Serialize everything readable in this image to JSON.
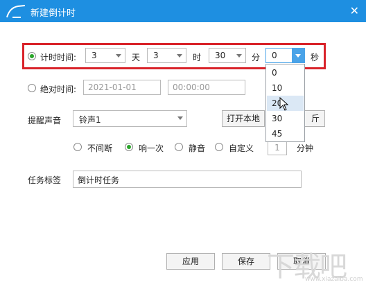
{
  "window": {
    "title": "新建倒计时",
    "close_glyph": "✕"
  },
  "countdown": {
    "label": "计时时间:",
    "days_value": "3",
    "days_unit": "天",
    "hours_value": "3",
    "hours_unit": "时",
    "minutes_value": "30",
    "minutes_unit": "分",
    "seconds_value": "0",
    "seconds_unit": "秒",
    "seconds_options": [
      "0",
      "10",
      "20",
      "30",
      "45"
    ],
    "hovered_option": "20"
  },
  "absolute": {
    "label": "绝对时间:",
    "date_placeholder": "2021-01-01",
    "time_placeholder": "00:00:00"
  },
  "sound": {
    "label": "提醒声音",
    "value": "铃声1",
    "open_local_button": "打开本地",
    "play_button_tail": "斤"
  },
  "repeat": {
    "options": [
      "不间断",
      "响一次",
      "静音",
      "自定义"
    ],
    "selected": "响一次",
    "custom_value": "1",
    "custom_unit": "分钟"
  },
  "tag": {
    "label": "任务标签",
    "value": "倒计时任务"
  },
  "footer": {
    "apply": "应用",
    "save": "保存",
    "cancel": "取消"
  },
  "watermark": {
    "text": "下载吧",
    "url": "www.xiazaiba.com"
  }
}
